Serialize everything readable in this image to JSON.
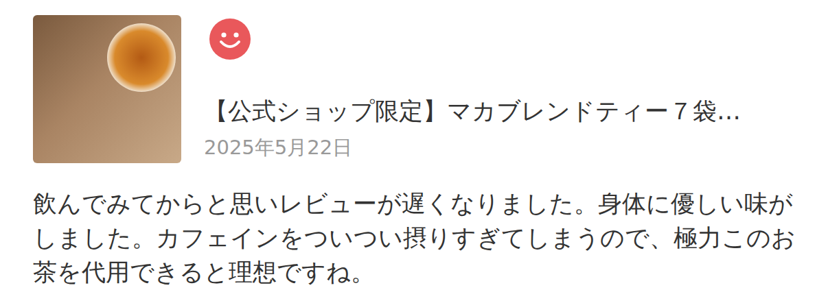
{
  "review": {
    "product_title": "【公式ショップ限定】マカブレンドティー７袋…",
    "date": "2025年5月22日",
    "body": "飲んでみてからと思いレビューが遅くなりました。身体に優しい味がしました。カフェインをついつい摂りすぎてしまうので、極力このお茶を代用できると理想ですね。"
  }
}
